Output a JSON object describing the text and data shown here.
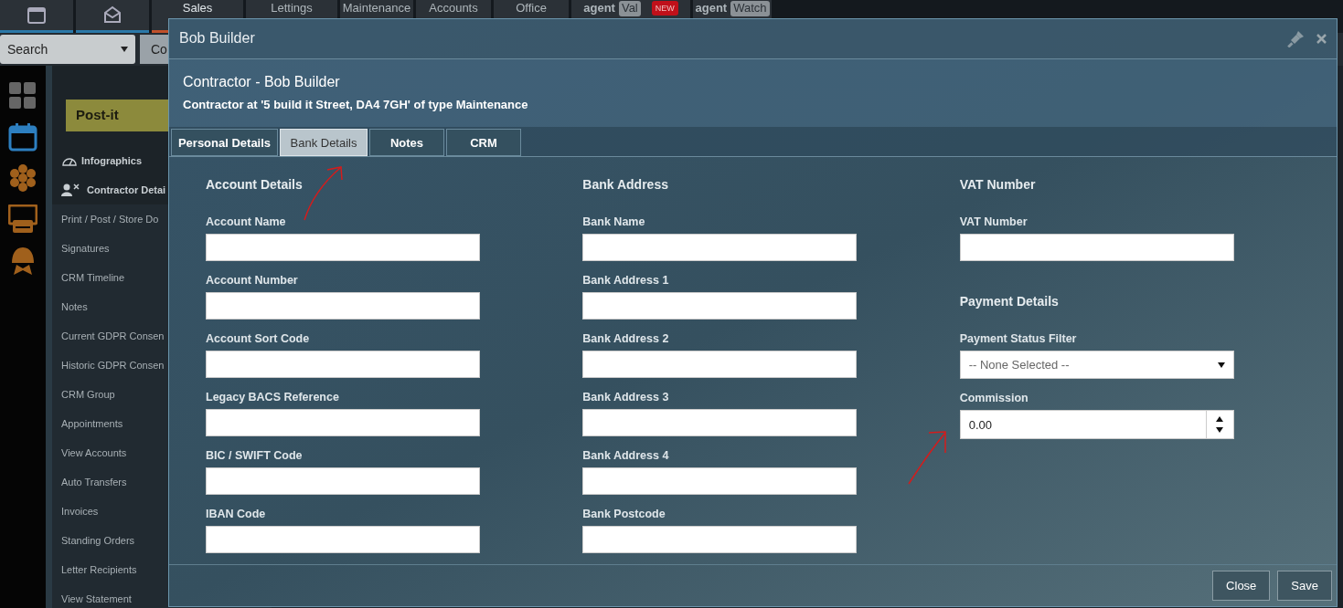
{
  "top_nav": [
    {
      "kind": "icon",
      "selected": false
    },
    {
      "kind": "icon",
      "selected": false
    },
    {
      "kind": "text",
      "label": "Sales",
      "selected": true
    },
    {
      "kind": "text",
      "label": "Lettings",
      "selected": false
    },
    {
      "kind": "text",
      "label": "Maintenance",
      "selected": false
    },
    {
      "kind": "text",
      "label": "Accounts",
      "selected": false
    },
    {
      "kind": "text",
      "label": "Office",
      "selected": false
    },
    {
      "kind": "agent",
      "label": "agent",
      "tag": "Val",
      "badge": "NEW",
      "selected": false
    },
    {
      "kind": "agent",
      "label": "agent",
      "tag": "Watch",
      "selected": false
    }
  ],
  "search": {
    "value": "Search",
    "next_button": "Co"
  },
  "postit": {
    "label": "Post-it"
  },
  "sidebar": {
    "items": [
      {
        "label": "Infographics",
        "kind": "heading"
      },
      {
        "label": "Contractor Detai",
        "kind": "heading"
      },
      {
        "label": "Print / Post / Store Do",
        "kind": "link"
      },
      {
        "label": "Signatures",
        "kind": "link"
      },
      {
        "label": "CRM Timeline",
        "kind": "link"
      },
      {
        "label": "Notes",
        "kind": "link"
      },
      {
        "label": "Current GDPR Consen",
        "kind": "link"
      },
      {
        "label": "Historic GDPR Consen",
        "kind": "link"
      },
      {
        "label": "CRM Group",
        "kind": "link"
      },
      {
        "label": "Appointments",
        "kind": "link"
      },
      {
        "label": "View Accounts",
        "kind": "link"
      },
      {
        "label": "Auto Transfers",
        "kind": "link"
      },
      {
        "label": "Invoices",
        "kind": "link"
      },
      {
        "label": "Standing Orders",
        "kind": "link"
      },
      {
        "label": "Letter Recipients",
        "kind": "link"
      },
      {
        "label": "View Statement",
        "kind": "link"
      }
    ]
  },
  "dialog": {
    "title": "Bob Builder",
    "heading": "Contractor - Bob Builder",
    "subheading": "Contractor at '5 build it Street, DA4 7GH' of type Maintenance",
    "tabs": [
      {
        "label": "Personal Details",
        "selected": false
      },
      {
        "label": "Bank Details",
        "selected": true
      },
      {
        "label": "Notes",
        "selected": false
      },
      {
        "label": "CRM",
        "selected": false
      }
    ],
    "columns": [
      {
        "sections": [
          {
            "title": "Account Details",
            "fields": [
              {
                "label": "Account Name",
                "kind": "text"
              },
              {
                "label": "Account Number",
                "kind": "text"
              },
              {
                "label": "Account Sort Code",
                "kind": "text"
              },
              {
                "label": "Legacy BACS Reference",
                "kind": "text"
              },
              {
                "label": "BIC / SWIFT Code",
                "kind": "text"
              },
              {
                "label": "IBAN Code",
                "kind": "text"
              }
            ]
          }
        ]
      },
      {
        "sections": [
          {
            "title": "Bank Address",
            "fields": [
              {
                "label": "Bank Name",
                "kind": "text"
              },
              {
                "label": "Bank Address 1",
                "kind": "text"
              },
              {
                "label": "Bank Address 2",
                "kind": "text"
              },
              {
                "label": "Bank Address 3",
                "kind": "text"
              },
              {
                "label": "Bank Address 4",
                "kind": "text"
              },
              {
                "label": "Bank Postcode",
                "kind": "text"
              }
            ]
          }
        ]
      },
      {
        "sections": [
          {
            "title": "VAT Number",
            "fields": [
              {
                "label": "VAT Number",
                "kind": "text"
              }
            ]
          },
          {
            "title": "Payment Details",
            "fields": [
              {
                "label": "Payment Status Filter",
                "kind": "select",
                "value": "-- None Selected --"
              },
              {
                "label": "Commission",
                "kind": "number",
                "value": "0.00"
              }
            ]
          }
        ]
      }
    ],
    "buttons": [
      "Close",
      "Save"
    ]
  }
}
